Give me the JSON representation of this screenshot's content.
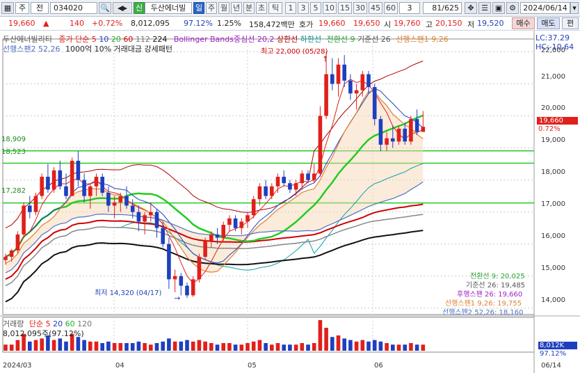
{
  "toolbar": {
    "market": "주",
    "prev": "전",
    "code": "034020",
    "name": "두산에너빌",
    "periods": [
      "일",
      "주",
      "월",
      "년",
      "분",
      "초",
      "틱"
    ],
    "minutes": [
      "1",
      "3",
      "5",
      "10",
      "15",
      "30",
      "45",
      "60"
    ],
    "interval": "3",
    "count": "81/625",
    "date": "2024/06/14"
  },
  "quote": {
    "price": "19,660",
    "change": "140",
    "change_pct": "+0.72%",
    "volume": "8,012,095",
    "vol_ratio": "97.12%",
    "turnover": "1.25%",
    "amount": "158,472백만",
    "bid_label": "호가",
    "bid1": "19,660",
    "bid2": "19,650",
    "open_label": "시",
    "open": "19,760",
    "high_label": "고",
    "high": "20,150",
    "low_label": "저",
    "low": "19,520",
    "buy": "매수",
    "sell": "매도",
    "order": "편"
  },
  "legends": {
    "title": "두산에너빌리티",
    "ma_label": "종가 단순",
    "ma5": "5",
    "ma10": "10",
    "ma20": "20",
    "ma60": "60",
    "ma112": "112",
    "ma224": "224",
    "bb": "Bollinger Bands중심선 20,2",
    "bb_up": "상한선",
    "bb_dn": "하한선",
    "ich_conv": "전환선 9",
    "ich_base": "기준선 26",
    "ich_span1": "선행스팬1 9,26",
    "ich_span2": "선행스팬2 52,26",
    "pattern": "1000억 10% 거래대금 강세패턴",
    "lc": "LC:37.29",
    "hc": "HC:-10.64"
  },
  "annotations": {
    "high": "최고 22,000 (05/28)",
    "low": "최저 14,320 (04/17)",
    "price_tag": "19,660",
    "pct_tag": "0.72%",
    "lvl1": "18,909",
    "lvl2": "18,523",
    "lvl3": "17,282"
  },
  "ichimoku_values": [
    "전환선 9: 20,025",
    "기준선 26: 19,485",
    "후행스팬 26: 19,660",
    "선행스팬1 9,26: 19,755",
    "선행스팬2 52,26: 18,160"
  ],
  "volume_panel": {
    "title": "거래량",
    "ma_label": "단순",
    "ma5": "5",
    "ma20": "20",
    "ma60": "60",
    "ma120": "120",
    "value": "8,012,095주(97.12%)",
    "tag_value": "8,012K",
    "tag_pct": "97.12%"
  },
  "x_labels": [
    "2024/03",
    "04",
    "05",
    "06",
    "06/14"
  ],
  "chart_data": {
    "type": "candlestick",
    "y_ticks": [
      "22,000",
      "21,000",
      "20,000",
      "19,000",
      "18,000",
      "17,000",
      "16,000",
      "15,000",
      "14,000"
    ],
    "ylim": [
      13800,
      22400
    ],
    "candles": [
      [
        15500,
        15700,
        15350,
        15600
      ],
      [
        15600,
        15850,
        15450,
        15800
      ],
      [
        15800,
        16400,
        15700,
        16300
      ],
      [
        16300,
        17300,
        16200,
        17200
      ],
      [
        17200,
        17500,
        16800,
        17000
      ],
      [
        17000,
        17600,
        16900,
        17500
      ],
      [
        17500,
        18200,
        17400,
        18100
      ],
      [
        18100,
        18500,
        17600,
        17700
      ],
      [
        17700,
        18400,
        17600,
        18300
      ],
      [
        18300,
        18600,
        17700,
        17800
      ],
      [
        17800,
        18200,
        17400,
        17500
      ],
      [
        17500,
        18700,
        17500,
        18600
      ],
      [
        18600,
        18900,
        17800,
        18000
      ],
      [
        18000,
        18200,
        17300,
        17500
      ],
      [
        17500,
        17900,
        17100,
        17800
      ],
      [
        17800,
        18200,
        17500,
        18100
      ],
      [
        18100,
        18200,
        17500,
        17600
      ],
      [
        17600,
        17800,
        17000,
        17200
      ],
      [
        17200,
        17500,
        16800,
        17300
      ],
      [
        17300,
        17600,
        17000,
        17500
      ],
      [
        17500,
        17800,
        17100,
        17200
      ],
      [
        17200,
        17400,
        16800,
        17000
      ],
      [
        17000,
        17200,
        16400,
        16700
      ],
      [
        16700,
        17000,
        16300,
        16900
      ],
      [
        16900,
        17300,
        16700,
        17000
      ],
      [
        17000,
        17100,
        16200,
        16500
      ],
      [
        16500,
        16700,
        15900,
        16000
      ],
      [
        16000,
        16200,
        14600,
        14900
      ],
      [
        14900,
        15200,
        14500,
        15000
      ],
      [
        15000,
        15100,
        14400,
        14700
      ],
      [
        14700,
        14800,
        14320,
        14400
      ],
      [
        14400,
        15000,
        14350,
        14900
      ],
      [
        14900,
        15700,
        14800,
        15600
      ],
      [
        15600,
        16200,
        15500,
        16100
      ],
      [
        16100,
        16400,
        15900,
        16300
      ],
      [
        16300,
        16500,
        16000,
        16200
      ],
      [
        16200,
        16700,
        16100,
        16600
      ],
      [
        16600,
        16900,
        16400,
        16800
      ],
      [
        16800,
        16900,
        16400,
        16500
      ],
      [
        16500,
        16800,
        16300,
        16700
      ],
      [
        16700,
        17000,
        16500,
        16900
      ],
      [
        16900,
        17500,
        16800,
        17400
      ],
      [
        17400,
        17900,
        17200,
        17800
      ],
      [
        17800,
        18000,
        17400,
        17500
      ],
      [
        17500,
        17900,
        17400,
        17800
      ],
      [
        17800,
        18200,
        17600,
        18100
      ],
      [
        18100,
        18300,
        17800,
        17900
      ],
      [
        17900,
        18000,
        17600,
        17700
      ],
      [
        17700,
        18000,
        17500,
        17900
      ],
      [
        17900,
        18300,
        17700,
        18200
      ],
      [
        18200,
        18300,
        17900,
        18000
      ],
      [
        18000,
        18500,
        17900,
        18200
      ],
      [
        18200,
        20300,
        18100,
        20000
      ],
      [
        20000,
        22000,
        19900,
        21300
      ],
      [
        21300,
        21800,
        20800,
        21000
      ],
      [
        21000,
        21800,
        20600,
        21600
      ],
      [
        21600,
        21900,
        20900,
        21100
      ],
      [
        21100,
        21300,
        20500,
        20700
      ],
      [
        20700,
        21000,
        20200,
        20800
      ],
      [
        20800,
        21400,
        20600,
        21300
      ],
      [
        21300,
        21400,
        20700,
        20900
      ],
      [
        20900,
        21000,
        19700,
        19900
      ],
      [
        19900,
        20000,
        18900,
        19100
      ],
      [
        19100,
        19500,
        18900,
        19300
      ],
      [
        19300,
        19700,
        19000,
        19200
      ],
      [
        19200,
        19700,
        19100,
        19600
      ],
      [
        19600,
        19800,
        19100,
        19200
      ],
      [
        19200,
        20000,
        19100,
        19900
      ],
      [
        19900,
        20200,
        19400,
        19500
      ],
      [
        19500,
        20150,
        19520,
        19660
      ]
    ],
    "volumes": [
      0.2,
      0.2,
      0.35,
      0.55,
      0.3,
      0.35,
      0.4,
      0.5,
      0.35,
      0.4,
      0.3,
      0.55,
      0.45,
      0.35,
      0.3,
      0.3,
      0.25,
      0.3,
      0.25,
      0.25,
      0.25,
      0.25,
      0.3,
      0.25,
      0.2,
      0.25,
      0.3,
      0.4,
      0.3,
      0.3,
      0.35,
      0.3,
      0.35,
      0.3,
      0.25,
      0.2,
      0.25,
      0.25,
      0.2,
      0.2,
      0.25,
      0.3,
      0.35,
      0.25,
      0.2,
      0.25,
      0.2,
      0.2,
      0.2,
      0.25,
      0.2,
      0.25,
      1.0,
      0.75,
      0.45,
      0.5,
      0.4,
      0.35,
      0.3,
      0.35,
      0.3,
      0.35,
      0.3,
      0.25,
      0.2,
      0.2,
      0.2,
      0.25,
      0.2,
      0.2
    ]
  }
}
